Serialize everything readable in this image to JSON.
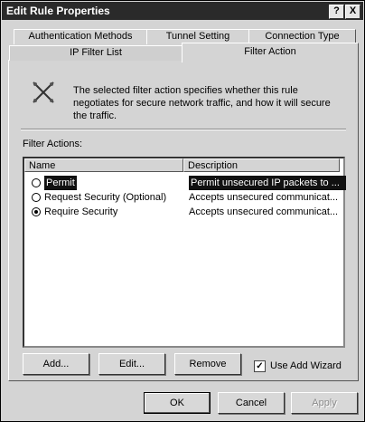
{
  "window": {
    "title": "Edit Rule Properties",
    "help_button": "?",
    "close_button": "X"
  },
  "tabs": {
    "row_back": [
      "Authentication Methods",
      "Tunnel Setting",
      "Connection Type"
    ],
    "row_front": [
      "IP Filter List",
      "Filter Action"
    ],
    "active": "Filter Action"
  },
  "panel": {
    "icon": "filter-action-icon",
    "description": "The selected filter action specifies whether this rule negotiates for secure network traffic, and how it will secure the traffic.",
    "filter_actions_label": "Filter Actions:",
    "columns": [
      "Name",
      "Description"
    ],
    "rows": [
      {
        "name": "Permit",
        "description": "Permit unsecured IP packets to ...",
        "selected": true,
        "checked": false
      },
      {
        "name": "Request Security (Optional)",
        "description": "Accepts unsecured communicat...",
        "selected": false,
        "checked": false
      },
      {
        "name": "Require Security",
        "description": "Accepts unsecured communicat...",
        "selected": false,
        "checked": true
      }
    ],
    "buttons": {
      "add": "Add...",
      "edit": "Edit...",
      "remove": "Remove"
    },
    "use_add_wizard": {
      "label": "Use Add Wizard",
      "checked": true
    }
  },
  "footer": {
    "ok": "OK",
    "cancel": "Cancel",
    "apply": "Apply"
  }
}
